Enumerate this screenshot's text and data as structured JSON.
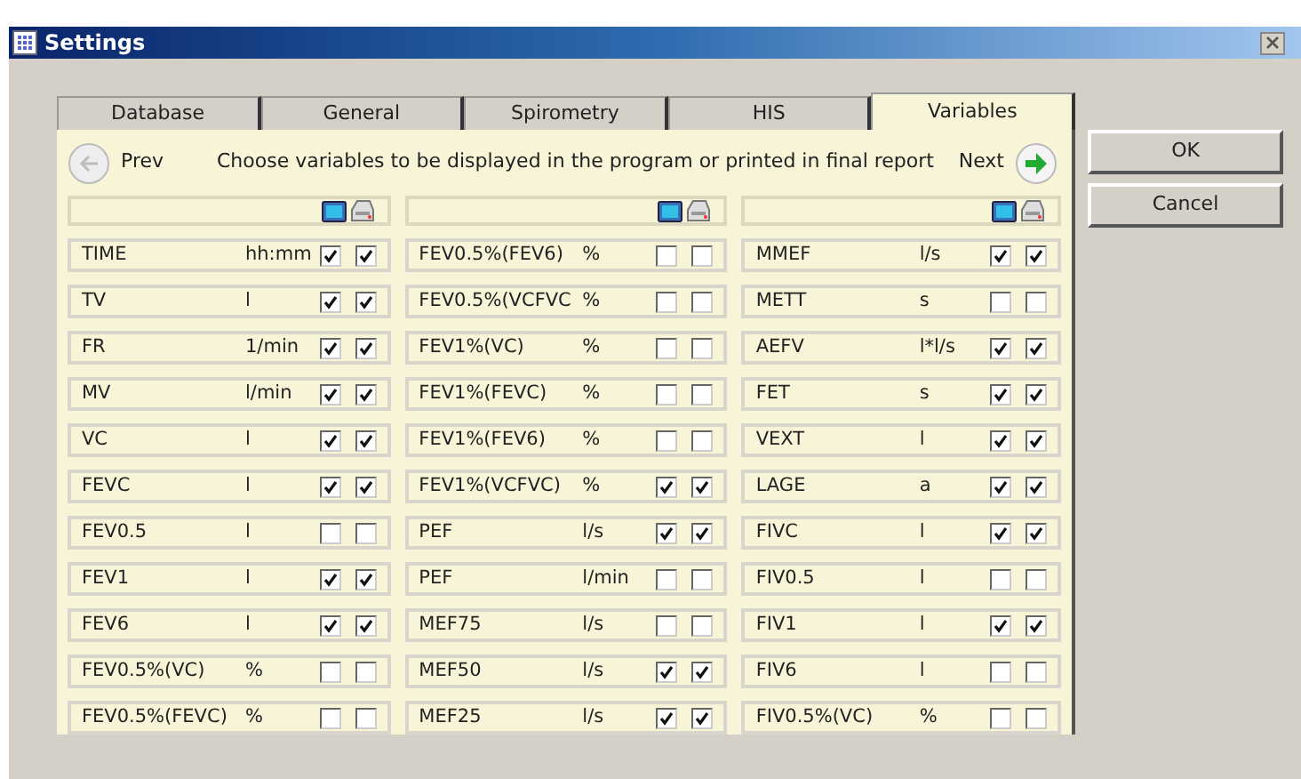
{
  "window": {
    "title": "Settings"
  },
  "tabs": [
    {
      "label": "Database",
      "selected": false
    },
    {
      "label": "General",
      "selected": false
    },
    {
      "label": "Spirometry",
      "selected": false
    },
    {
      "label": "HIS",
      "selected": false
    },
    {
      "label": "Variables",
      "selected": true
    }
  ],
  "nav": {
    "prev": "Prev",
    "instruction": "Choose variables to be displayed in the program or printed in final report",
    "next": "Next"
  },
  "buttons": [
    "OK",
    "Cancel"
  ],
  "columns": [
    {
      "rows": [
        {
          "name": "TIME",
          "unit": "hh:mm",
          "display": true,
          "print": true
        },
        {
          "name": "TV",
          "unit": "l",
          "display": true,
          "print": true
        },
        {
          "name": "FR",
          "unit": "1/min",
          "display": true,
          "print": true
        },
        {
          "name": "MV",
          "unit": "l/min",
          "display": true,
          "print": true
        },
        {
          "name": "VC",
          "unit": "l",
          "display": true,
          "print": true
        },
        {
          "name": "FEVC",
          "unit": "l",
          "display": true,
          "print": true
        },
        {
          "name": "FEV0.5",
          "unit": "l",
          "display": false,
          "print": false
        },
        {
          "name": "FEV1",
          "unit": "l",
          "display": true,
          "print": true
        },
        {
          "name": "FEV6",
          "unit": "l",
          "display": true,
          "print": true
        },
        {
          "name": "FEV0.5%(VC)",
          "unit": "%",
          "display": false,
          "print": false
        },
        {
          "name": "FEV0.5%(FEVC)",
          "unit": "%",
          "display": false,
          "print": false
        }
      ]
    },
    {
      "rows": [
        {
          "name": "FEV0.5%(FEV6)",
          "unit": "%",
          "display": false,
          "print": false
        },
        {
          "name": "FEV0.5%(VCFVC",
          "unit": "%",
          "display": false,
          "print": false
        },
        {
          "name": "FEV1%(VC)",
          "unit": "%",
          "display": false,
          "print": false
        },
        {
          "name": "FEV1%(FEVC)",
          "unit": "%",
          "display": false,
          "print": false
        },
        {
          "name": "FEV1%(FEV6)",
          "unit": "%",
          "display": false,
          "print": false
        },
        {
          "name": "FEV1%(VCFVC)",
          "unit": "%",
          "display": true,
          "print": true
        },
        {
          "name": "PEF",
          "unit": "l/s",
          "display": true,
          "print": true
        },
        {
          "name": "PEF",
          "unit": "l/min",
          "display": false,
          "print": false
        },
        {
          "name": "MEF75",
          "unit": "l/s",
          "display": false,
          "print": false
        },
        {
          "name": "MEF50",
          "unit": "l/s",
          "display": true,
          "print": true
        },
        {
          "name": "MEF25",
          "unit": "l/s",
          "display": true,
          "print": true
        }
      ]
    },
    {
      "rows": [
        {
          "name": "MMEF",
          "unit": "l/s",
          "display": true,
          "print": true
        },
        {
          "name": "METT",
          "unit": "s",
          "display": false,
          "print": false
        },
        {
          "name": "AEFV",
          "unit": "l*l/s",
          "display": true,
          "print": true
        },
        {
          "name": "FET",
          "unit": "s",
          "display": true,
          "print": true
        },
        {
          "name": "VEXT",
          "unit": "l",
          "display": true,
          "print": true
        },
        {
          "name": "LAGE",
          "unit": "a",
          "display": true,
          "print": true
        },
        {
          "name": "FIVC",
          "unit": "l",
          "display": true,
          "print": true
        },
        {
          "name": "FIV0.5",
          "unit": "l",
          "display": false,
          "print": false
        },
        {
          "name": "FIV1",
          "unit": "l",
          "display": true,
          "print": true
        },
        {
          "name": "FIV6",
          "unit": "l",
          "display": false,
          "print": false
        },
        {
          "name": "FIV0.5%(VC)",
          "unit": "%",
          "display": false,
          "print": false
        }
      ]
    }
  ]
}
